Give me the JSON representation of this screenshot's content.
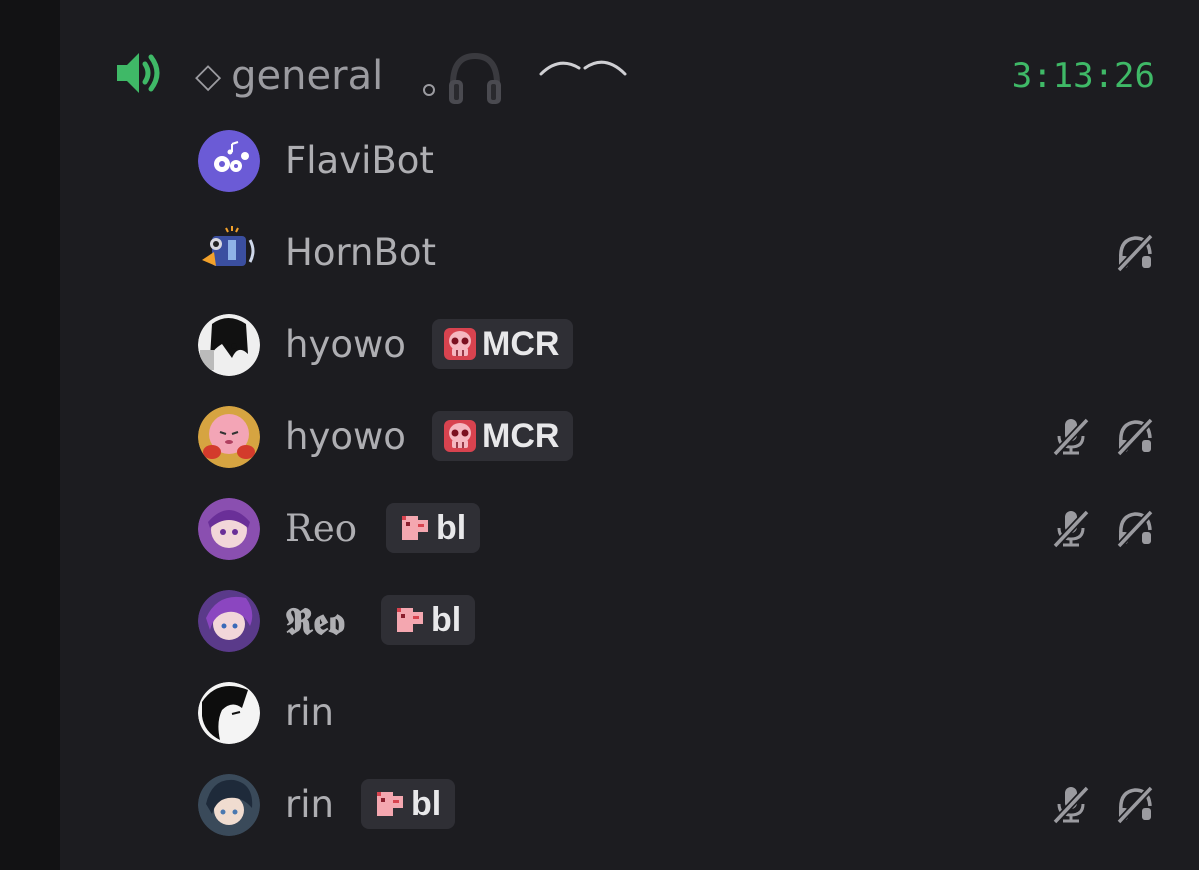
{
  "channel": {
    "name": "general",
    "prefix": "◇",
    "timer": "3:13:26",
    "accent": "#3fb967"
  },
  "users": [
    {
      "name": "FlaviBot",
      "tag": null,
      "mic_muted": false,
      "deafened": false,
      "avatar": "flavibot-avatar"
    },
    {
      "name": "HornBot",
      "tag": null,
      "mic_muted": false,
      "deafened": true,
      "avatar": "hornbot-avatar"
    },
    {
      "name": "hyowo",
      "tag": "MCR",
      "tag_icon": "skull-icon",
      "mic_muted": false,
      "deafened": false,
      "avatar": "hyowo-avatar-1"
    },
    {
      "name": "hyowo",
      "tag": "MCR",
      "tag_icon": "skull-icon",
      "mic_muted": true,
      "deafened": true,
      "avatar": "hyowo-avatar-2"
    },
    {
      "name": "Reo",
      "tag": "bl",
      "tag_icon": "pink-creature-icon",
      "mic_muted": true,
      "deafened": true,
      "avatar": "reo-avatar-1"
    },
    {
      "name": "𝕽𝖊𝖔",
      "tag": "bl",
      "tag_icon": "pink-creature-icon",
      "mic_muted": false,
      "deafened": false,
      "avatar": "reo-avatar-2"
    },
    {
      "name": "rin",
      "tag": null,
      "mic_muted": false,
      "deafened": false,
      "avatar": "rin-avatar-1"
    },
    {
      "name": "rin",
      "tag": "bl",
      "tag_icon": "pink-creature-icon",
      "mic_muted": true,
      "deafened": true,
      "avatar": "rin-avatar-2"
    }
  ]
}
